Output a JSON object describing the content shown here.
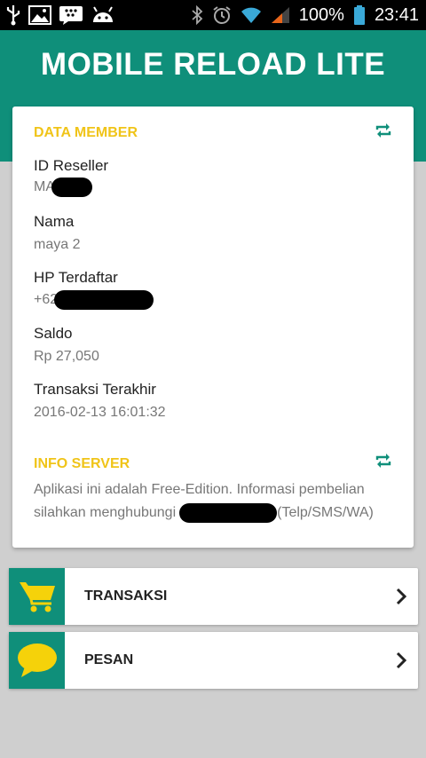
{
  "status_bar": {
    "battery": "100%",
    "time": "23:41"
  },
  "app": {
    "title": "MOBILE RELOAD LITE"
  },
  "data_member": {
    "title": "DATA MEMBER",
    "fields": [
      {
        "label": "ID Reseller",
        "value": "MA"
      },
      {
        "label": "Nama",
        "value": "maya 2"
      },
      {
        "label": "HP Terdaftar",
        "value": "+62"
      },
      {
        "label": "Saldo",
        "value": "Rp 27,050"
      },
      {
        "label": "Transaksi Terakhir",
        "value": "2016-02-13 16:01:32"
      }
    ]
  },
  "info_server": {
    "title": "INFO SERVER",
    "line1": "Aplikasi ini adalah Free-Edition. Informasi pembelian",
    "line2_prefix": "silahkan menghubungi",
    "line2_suffix": "(Telp/SMS/WA)"
  },
  "menu": [
    {
      "label": "TRANSAKSI",
      "icon": "cart-icon"
    },
    {
      "label": "PESAN",
      "icon": "chat-bubble-icon"
    }
  ],
  "colors": {
    "primary": "#0f8f7a",
    "accent": "#f0c419",
    "background": "#cfcfcf"
  }
}
